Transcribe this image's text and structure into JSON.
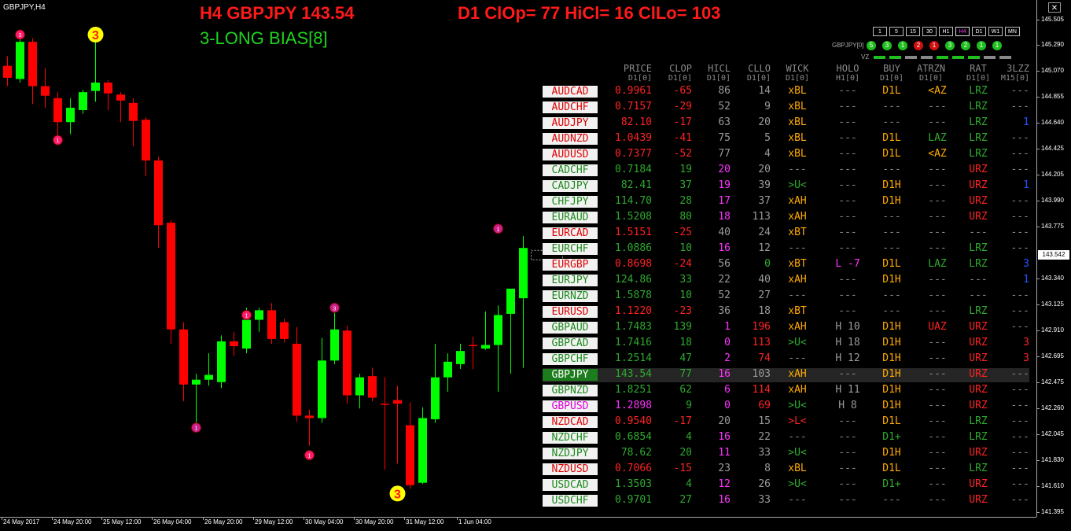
{
  "window": {
    "symbol_title": "GBPJPY,H4",
    "close": "✕"
  },
  "header": {
    "h4_title": "H4 GBPJPY 143.54",
    "d1_title": "D1 ClOp= 77 HiCl= 16 ClLo= 103",
    "bias": "3-LONG BIAS[8]"
  },
  "timeframes": [
    {
      "label": "1",
      "active": false
    },
    {
      "label": "5",
      "active": false
    },
    {
      "label": "15",
      "active": false
    },
    {
      "label": "30",
      "active": false
    },
    {
      "label": "H1",
      "active": false
    },
    {
      "label": "H4",
      "active": true
    },
    {
      "label": "D1",
      "active": false
    },
    {
      "label": "W1",
      "active": false
    },
    {
      "label": "MN",
      "active": false
    }
  ],
  "status_row": {
    "label": "GBPJPY[0]",
    "dots": [
      {
        "text": "5",
        "color": "#1fbf1f"
      },
      {
        "text": "3",
        "color": "#1fbf1f"
      },
      {
        "text": "1",
        "color": "#1fbf1f"
      },
      {
        "text": "2",
        "color": "#d01010"
      },
      {
        "text": "1",
        "color": "#d01010"
      },
      {
        "text": "3",
        "color": "#1fbf1f"
      },
      {
        "text": "2",
        "color": "#1fbf1f"
      },
      {
        "text": "1",
        "color": "#1fbf1f"
      },
      {
        "text": "1",
        "color": "#1fbf1f"
      }
    ]
  },
  "vz": {
    "label": "VZ",
    "bars": [
      "#1fbf1f",
      "#1fbf1f",
      "#888",
      "#888",
      "#1fbf1f",
      "#1fbf1f",
      "#1fbf1f",
      "#888",
      "#888"
    ]
  },
  "table": {
    "headers": [
      "PRICE",
      "CLOP",
      "HICL",
      "CLLO",
      "WICK",
      "HOLO",
      "BUY",
      "ATRZN",
      "RAT",
      "3LZZ"
    ],
    "subheaders": [
      "D1[0]",
      "D1[0]",
      "D1[0]",
      "D1[0]",
      "D1[0]",
      "H1[0]",
      "D1[0]",
      "D1[0]",
      "D1[0]",
      "M15[0]"
    ],
    "rows": [
      {
        "sym": "AUDCAD",
        "c": "r",
        "price": "0.9961",
        "clop": "-65",
        "hicl": "86",
        "cllo": "14",
        "wick": "xBL",
        "holo": "---",
        "buy": "D1L",
        "atrzn": "<AZ",
        "rat": "LRZ",
        "lzz": "---",
        "wc": "o",
        "hc": "m",
        "hlc": "m",
        "lc": "m",
        "ac": "o",
        "rc": "g",
        "zc": "m"
      },
      {
        "sym": "AUDCHF",
        "c": "r",
        "price": "0.7157",
        "clop": "-29",
        "hicl": "52",
        "cllo": "9",
        "wick": "xBL",
        "holo": "---",
        "buy": "---",
        "atrzn": "---",
        "rat": "LRZ",
        "lzz": "---",
        "wc": "o",
        "hc": "m",
        "hlc": "m",
        "lc": "m",
        "ac": "m",
        "rc": "g",
        "zc": "m"
      },
      {
        "sym": "AUDJPY",
        "c": "r",
        "price": "82.10",
        "clop": "-17",
        "hicl": "63",
        "cllo": "20",
        "wick": "xBL",
        "holo": "---",
        "buy": "---",
        "atrzn": "---",
        "rat": "LRZ",
        "lzz": "1",
        "wc": "o",
        "hc": "m",
        "hlc": "m",
        "lc": "m",
        "ac": "m",
        "rc": "g",
        "zc": "b"
      },
      {
        "sym": "AUDNZD",
        "c": "r",
        "price": "1.0439",
        "clop": "-41",
        "hicl": "75",
        "cllo": "5",
        "wick": "xBL",
        "holo": "---",
        "buy": "D1L",
        "atrzn": "LAZ",
        "rat": "LRZ",
        "lzz": "---",
        "wc": "o",
        "hc": "m",
        "hlc": "m",
        "lc": "m",
        "ac": "g",
        "rc": "g",
        "zc": "m"
      },
      {
        "sym": "AUDUSD",
        "c": "r",
        "price": "0.7377",
        "clop": "-52",
        "hicl": "77",
        "cllo": "4",
        "wick": "xBL",
        "holo": "---",
        "buy": "D1L",
        "atrzn": "<AZ",
        "rat": "LRZ",
        "lzz": "---",
        "wc": "o",
        "hc": "m",
        "hlc": "m",
        "lc": "m",
        "ac": "o",
        "rc": "g",
        "zc": "m"
      },
      {
        "sym": "CADCHF",
        "c": "g",
        "price": "0.7184",
        "clop": "19",
        "hicl": "20",
        "cllo": "20",
        "wick": "---",
        "holo": "---",
        "buy": "---",
        "atrzn": "---",
        "rat": "URZ",
        "lzz": "---",
        "wc": "m",
        "hc": "p",
        "hlc": "gy",
        "lc": "m",
        "ac": "m",
        "rc": "r",
        "zc": "m"
      },
      {
        "sym": "CADJPY",
        "c": "g",
        "price": "82.41",
        "clop": "37",
        "hicl": "19",
        "cllo": "39",
        "wick": ">U<",
        "holo": "---",
        "buy": "D1H",
        "atrzn": "---",
        "rat": "URZ",
        "lzz": "1",
        "wc": "g",
        "hc": "p",
        "hlc": "gy",
        "lc": "m",
        "ac": "m",
        "rc": "r",
        "zc": "b"
      },
      {
        "sym": "CHFJPY",
        "c": "g",
        "price": "114.70",
        "clop": "28",
        "hicl": "17",
        "cllo": "37",
        "wick": "xAH",
        "holo": "---",
        "buy": "D1H",
        "atrzn": "---",
        "rat": "URZ",
        "lzz": "---",
        "wc": "o",
        "hc": "p",
        "hlc": "gy",
        "lc": "m",
        "ac": "m",
        "rc": "r",
        "zc": "m"
      },
      {
        "sym": "EURAUD",
        "c": "g",
        "price": "1.5208",
        "clop": "80",
        "hicl": "18",
        "cllo": "113",
        "wick": "xAH",
        "holo": "---",
        "buy": "---",
        "atrzn": "---",
        "rat": "URZ",
        "lzz": "---",
        "wc": "o",
        "hc": "p",
        "hlc": "gy",
        "lc": "m",
        "ac": "m",
        "rc": "r",
        "zc": "m"
      },
      {
        "sym": "EURCAD",
        "c": "r",
        "price": "1.5151",
        "clop": "-25",
        "hicl": "40",
        "cllo": "24",
        "wick": "xBT",
        "holo": "---",
        "buy": "---",
        "atrzn": "---",
        "rat": "---",
        "lzz": "---",
        "wc": "o",
        "hc": "m",
        "hlc": "m",
        "lc": "m",
        "ac": "m",
        "rc": "m",
        "zc": "m"
      },
      {
        "sym": "EURCHF",
        "c": "g",
        "price": "1.0886",
        "clop": "10",
        "hicl": "16",
        "cllo": "12",
        "wick": "---",
        "holo": "---",
        "buy": "---",
        "atrzn": "---",
        "rat": "LRZ",
        "lzz": "---",
        "wc": "m",
        "hc": "p",
        "hlc": "p",
        "lc": "m",
        "ac": "m",
        "rc": "g",
        "zc": "m"
      },
      {
        "sym": "EURGBP",
        "c": "r",
        "price": "0.8698",
        "clop": "-24",
        "hicl": "56",
        "cllo": "0",
        "wick": "xBT",
        "holo": "L -7",
        "buy": "D1L",
        "atrzn": "LAZ",
        "rat": "LRZ",
        "lzz": "3",
        "wc": "o",
        "hc": "m",
        "hlc": "p",
        "lc": "g",
        "ac": "g",
        "rc": "g",
        "zc": "b"
      },
      {
        "sym": "EURJPY",
        "c": "g",
        "price": "124.86",
        "clop": "33",
        "hicl": "22",
        "cllo": "40",
        "wick": "xAH",
        "holo": "---",
        "buy": "D1H",
        "atrzn": "---",
        "rat": "---",
        "lzz": "1",
        "wc": "o",
        "hc": "m",
        "hlc": "gy",
        "lc": "m",
        "ac": "m",
        "rc": "m",
        "zc": "b"
      },
      {
        "sym": "EURNZD",
        "c": "g",
        "price": "1.5878",
        "clop": "10",
        "hicl": "52",
        "cllo": "27",
        "wick": "---",
        "holo": "---",
        "buy": "---",
        "atrzn": "---",
        "rat": "---",
        "lzz": "---",
        "wc": "m",
        "hc": "m",
        "hlc": "gy",
        "lc": "m",
        "ac": "m",
        "rc": "m",
        "zc": "m"
      },
      {
        "sym": "EURUSD",
        "c": "r",
        "price": "1.1220",
        "clop": "-23",
        "hicl": "36",
        "cllo": "18",
        "wick": "xBT",
        "holo": "---",
        "buy": "---",
        "atrzn": "---",
        "rat": "LRZ",
        "lzz": "---",
        "wc": "o",
        "hc": "m",
        "hlc": "p",
        "lc": "m",
        "ac": "m",
        "rc": "g",
        "zc": "m"
      },
      {
        "sym": "GBPAUD",
        "c": "g",
        "price": "1.7483",
        "clop": "139",
        "hicl": "1",
        "cllo": "196",
        "wick": "xAH",
        "holo": "H 10",
        "buy": "D1H",
        "atrzn": "UAZ",
        "rat": "URZ",
        "lzz": "---",
        "wc": "o",
        "hc": "p",
        "hlc": "gy",
        "lc": "r",
        "ac": "r",
        "rc": "r",
        "zc": "m"
      },
      {
        "sym": "GBPCAD",
        "c": "g",
        "price": "1.7416",
        "clop": "18",
        "hicl": "0",
        "cllo": "113",
        "wick": ">U<",
        "holo": "H 18",
        "buy": "D1H",
        "atrzn": "---",
        "rat": "URZ",
        "lzz": "3",
        "wc": "g",
        "hc": "p",
        "hlc": "gy",
        "lc": "r",
        "ac": "m",
        "rc": "r",
        "zc": "r"
      },
      {
        "sym": "GBPCHF",
        "c": "g",
        "price": "1.2514",
        "clop": "47",
        "hicl": "2",
        "cllo": "74",
        "wick": "---",
        "holo": "H 12",
        "buy": "D1H",
        "atrzn": "---",
        "rat": "URZ",
        "lzz": "3",
        "wc": "m",
        "hc": "p",
        "hlc": "gy",
        "lc": "r",
        "ac": "m",
        "rc": "r",
        "zc": "r"
      },
      {
        "sym": "GBPJPY",
        "c": "g",
        "sel": true,
        "price": "143.54",
        "clop": "77",
        "hicl": "16",
        "cllo": "103",
        "wick": "xAH",
        "holo": "---",
        "buy": "D1H",
        "atrzn": "---",
        "rat": "URZ",
        "lzz": "---",
        "wc": "o",
        "hc": "p",
        "hlc": "gy",
        "lc": "m",
        "ac": "m",
        "rc": "r",
        "zc": "m"
      },
      {
        "sym": "GBPNZD",
        "c": "g",
        "price": "1.8251",
        "clop": "62",
        "hicl": "6",
        "cllo": "114",
        "wick": "xAH",
        "holo": "H 11",
        "buy": "D1H",
        "atrzn": "---",
        "rat": "URZ",
        "lzz": "---",
        "wc": "o",
        "hc": "p",
        "hlc": "gy",
        "lc": "r",
        "ac": "m",
        "rc": "r",
        "zc": "m"
      },
      {
        "sym": "GBPUSD",
        "c": "p",
        "price": "1.2898",
        "clop": "9",
        "hicl": "0",
        "cllo": "69",
        "wick": ">U<",
        "holo": "H 8",
        "buy": "D1H",
        "atrzn": "---",
        "rat": "URZ",
        "lzz": "---",
        "wc": "g",
        "hc": "p",
        "hlc": "gy",
        "lc": "r",
        "ac": "m",
        "rc": "r",
        "zc": "m"
      },
      {
        "sym": "NZDCAD",
        "c": "r",
        "price": "0.9540",
        "clop": "-17",
        "hicl": "20",
        "cllo": "15",
        "wick": ">L<",
        "holo": "---",
        "buy": "D1L",
        "atrzn": "---",
        "rat": "LRZ",
        "lzz": "---",
        "wc": "r",
        "hc": "m",
        "hlc": "p",
        "lc": "m",
        "ac": "m",
        "rc": "g",
        "zc": "m"
      },
      {
        "sym": "NZDCHF",
        "c": "g",
        "price": "0.6854",
        "clop": "4",
        "hicl": "16",
        "cllo": "22",
        "wick": "---",
        "holo": "---",
        "buy": "D1+",
        "atrzn": "---",
        "rat": "LRZ",
        "lzz": "---",
        "wc": "m",
        "hc": "p",
        "hlc": "p",
        "lc": "m",
        "ac": "m",
        "rc": "g",
        "zc": "m"
      },
      {
        "sym": "NZDJPY",
        "c": "g",
        "price": "78.62",
        "clop": "20",
        "hicl": "11",
        "cllo": "33",
        "wick": ">U<",
        "holo": "---",
        "buy": "D1H",
        "atrzn": "---",
        "rat": "URZ",
        "lzz": "---",
        "wc": "g",
        "hc": "p",
        "hlc": "gy",
        "lc": "m",
        "ac": "m",
        "rc": "r",
        "zc": "m"
      },
      {
        "sym": "NZDUSD",
        "c": "r",
        "price": "0.7066",
        "clop": "-15",
        "hicl": "23",
        "cllo": "8",
        "wick": "xBL",
        "holo": "---",
        "buy": "D1L",
        "atrzn": "---",
        "rat": "LRZ",
        "lzz": "---",
        "wc": "o",
        "hc": "m",
        "hlc": "p",
        "lc": "m",
        "ac": "m",
        "rc": "g",
        "zc": "m"
      },
      {
        "sym": "USDCAD",
        "c": "g",
        "price": "1.3503",
        "clop": "4",
        "hicl": "12",
        "cllo": "26",
        "wick": ">U<",
        "holo": "---",
        "buy": "D1+",
        "atrzn": "---",
        "rat": "URZ",
        "lzz": "---",
        "wc": "g",
        "hc": "p",
        "hlc": "gy",
        "lc": "m",
        "ac": "m",
        "rc": "r",
        "zc": "m"
      },
      {
        "sym": "USDCHF",
        "c": "g",
        "price": "0.9701",
        "clop": "27",
        "hicl": "16",
        "cllo": "33",
        "wick": "---",
        "holo": "---",
        "buy": "---",
        "atrzn": "---",
        "rat": "URZ",
        "lzz": "---",
        "wc": "m",
        "hc": "p",
        "hlc": "gy",
        "lc": "m",
        "ac": "m",
        "rc": "r",
        "zc": "m"
      }
    ]
  },
  "price_axis": {
    "labels": [
      "145.505",
      "145.290",
      "145.070",
      "144.855",
      "144.640",
      "144.425",
      "144.205",
      "143.990",
      "143.775",
      "143.340",
      "143.125",
      "142.910",
      "142.695",
      "142.475",
      "142.260",
      "142.045",
      "141.830",
      "141.610",
      "141.395"
    ],
    "current": "143.542"
  },
  "time_axis": [
    "24 May 2017",
    "24 May 20:00",
    "25 May 12:00",
    "26 May 04:00",
    "26 May 20:00",
    "29 May 12:00",
    "30 May 04:00",
    "30 May 20:00",
    "31 May 12:00",
    "1 Jun 04:00"
  ],
  "chart_data": {
    "type": "candlestick",
    "symbol": "GBPJPY",
    "timeframe": "H4",
    "ylim": [
      141.395,
      145.505
    ],
    "candles": [
      {
        "o": 145.12,
        "h": 145.2,
        "l": 144.95,
        "c": 145.02
      },
      {
        "o": 145.01,
        "h": 145.42,
        "l": 144.98,
        "c": 145.32
      },
      {
        "o": 145.32,
        "h": 145.35,
        "l": 144.8,
        "c": 144.95
      },
      {
        "o": 144.95,
        "h": 145.1,
        "l": 144.77,
        "c": 144.87
      },
      {
        "o": 144.85,
        "h": 144.9,
        "l": 144.5,
        "c": 144.65
      },
      {
        "o": 144.65,
        "h": 144.85,
        "l": 144.55,
        "c": 144.77
      },
      {
        "o": 144.75,
        "h": 144.92,
        "l": 144.72,
        "c": 144.9
      },
      {
        "o": 144.91,
        "h": 145.35,
        "l": 144.82,
        "c": 144.98
      },
      {
        "o": 144.98,
        "h": 145.0,
        "l": 144.75,
        "c": 144.89
      },
      {
        "o": 144.88,
        "h": 144.9,
        "l": 144.65,
        "c": 144.83
      },
      {
        "o": 144.81,
        "h": 144.85,
        "l": 144.45,
        "c": 144.66
      },
      {
        "o": 144.67,
        "h": 144.69,
        "l": 144.2,
        "c": 144.33
      },
      {
        "o": 144.33,
        "h": 144.36,
        "l": 143.6,
        "c": 143.79
      },
      {
        "o": 143.81,
        "h": 143.83,
        "l": 142.8,
        "c": 142.92
      },
      {
        "o": 142.92,
        "h": 142.98,
        "l": 142.32,
        "c": 142.46
      },
      {
        "o": 142.46,
        "h": 142.55,
        "l": 142.1,
        "c": 142.5
      },
      {
        "o": 142.5,
        "h": 142.72,
        "l": 142.45,
        "c": 142.54
      },
      {
        "o": 142.48,
        "h": 142.87,
        "l": 142.43,
        "c": 142.82
      },
      {
        "o": 142.82,
        "h": 142.9,
        "l": 142.7,
        "c": 142.78
      },
      {
        "o": 142.76,
        "h": 143.1,
        "l": 142.72,
        "c": 143.0
      },
      {
        "o": 143.0,
        "h": 143.1,
        "l": 142.9,
        "c": 143.08
      },
      {
        "o": 143.08,
        "h": 143.14,
        "l": 142.8,
        "c": 142.84
      },
      {
        "o": 142.98,
        "h": 143.01,
        "l": 142.81,
        "c": 142.84
      },
      {
        "o": 142.8,
        "h": 142.94,
        "l": 142.15,
        "c": 142.2
      },
      {
        "o": 142.2,
        "h": 142.25,
        "l": 141.95,
        "c": 142.18
      },
      {
        "o": 142.18,
        "h": 142.85,
        "l": 142.14,
        "c": 142.66
      },
      {
        "o": 142.66,
        "h": 143.14,
        "l": 142.63,
        "c": 142.92
      },
      {
        "o": 142.91,
        "h": 142.95,
        "l": 142.3,
        "c": 142.37
      },
      {
        "o": 142.37,
        "h": 142.55,
        "l": 142.26,
        "c": 142.52
      },
      {
        "o": 142.53,
        "h": 142.6,
        "l": 142.32,
        "c": 142.35
      },
      {
        "o": 142.3,
        "h": 142.52,
        "l": 141.75,
        "c": 142.29
      },
      {
        "o": 142.33,
        "h": 142.45,
        "l": 141.8,
        "c": 142.3
      },
      {
        "o": 142.12,
        "h": 142.31,
        "l": 141.59,
        "c": 141.62
      },
      {
        "o": 141.64,
        "h": 142.27,
        "l": 141.63,
        "c": 142.18
      },
      {
        "o": 142.17,
        "h": 142.8,
        "l": 142.14,
        "c": 142.52
      },
      {
        "o": 142.52,
        "h": 142.72,
        "l": 142.4,
        "c": 142.65
      },
      {
        "o": 142.63,
        "h": 142.8,
        "l": 142.59,
        "c": 142.74
      },
      {
        "o": 142.79,
        "h": 142.86,
        "l": 142.59,
        "c": 142.78
      },
      {
        "o": 142.76,
        "h": 143.07,
        "l": 142.75,
        "c": 142.79
      },
      {
        "o": 142.79,
        "h": 143.12,
        "l": 142.4,
        "c": 143.04
      },
      {
        "o": 143.05,
        "h": 143.25,
        "l": 142.55,
        "c": 143.26
      },
      {
        "o": 143.18,
        "h": 143.7,
        "l": 142.6,
        "c": 143.6
      }
    ],
    "markers": [
      {
        "i": 1,
        "price": 145.38,
        "text": "3",
        "color": "#ff1a6a",
        "big": false
      },
      {
        "i": 4,
        "price": 144.5,
        "text": "1",
        "color": "#ff1a6a",
        "big": false
      },
      {
        "i": 7,
        "price": 145.38,
        "text": "3",
        "color": "#ffff00",
        "big": true
      },
      {
        "i": 15,
        "price": 142.1,
        "text": "1",
        "color": "#cc1f8a",
        "big": false
      },
      {
        "i": 19,
        "price": 143.04,
        "text": "1",
        "color": "#ff1a6a",
        "big": false
      },
      {
        "i": 24,
        "price": 141.87,
        "text": "1",
        "color": "#ff1a6a",
        "big": false
      },
      {
        "i": 26,
        "price": 143.1,
        "text": "3",
        "color": "#cc1f8a",
        "big": false
      },
      {
        "i": 31,
        "price": 141.55,
        "text": "3",
        "color": "#ffff00",
        "big": true
      },
      {
        "i": 39,
        "price": 143.76,
        "text": "1",
        "color": "#cc1f8a",
        "big": false
      }
    ]
  }
}
